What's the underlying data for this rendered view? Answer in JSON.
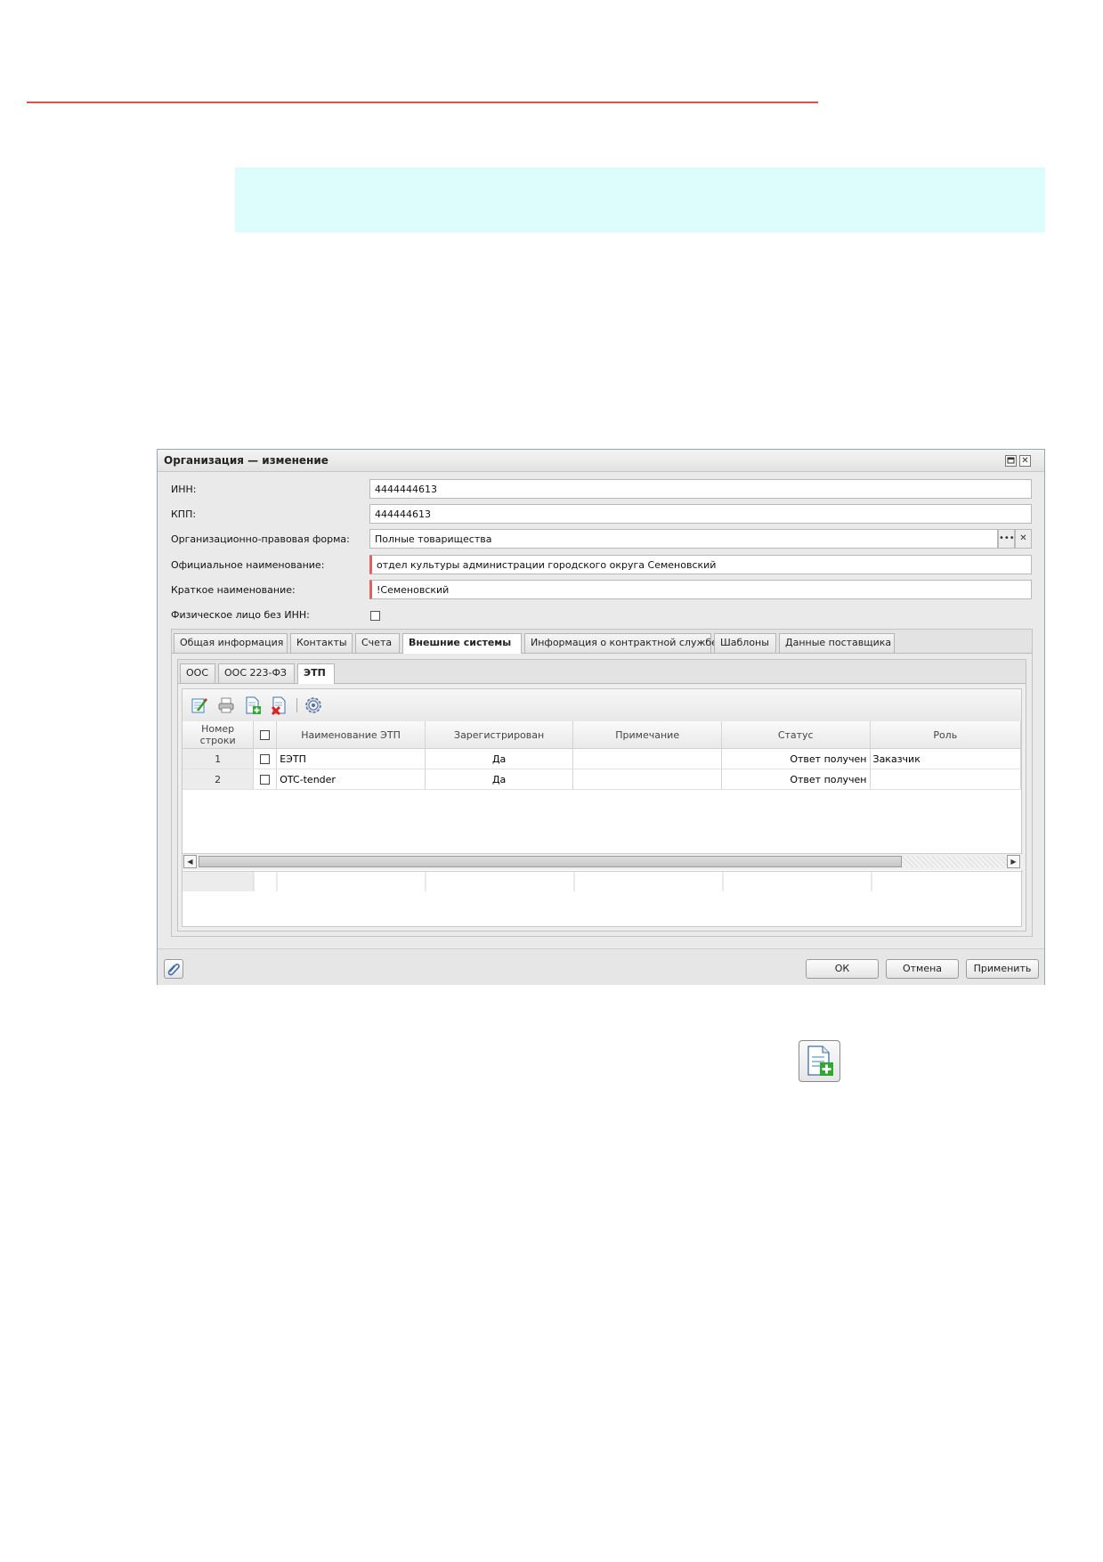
{
  "dialog": {
    "title": "Организация — изменение"
  },
  "form": {
    "inn": {
      "label": "ИНН:",
      "value": "4444444613"
    },
    "kpp": {
      "label": "КПП:",
      "value": "444444613"
    },
    "opf": {
      "label": "Организационно-правовая форма:",
      "value": "Полные товарищества"
    },
    "official_name": {
      "label": "Официальное наименование:",
      "value": "отдел культуры администрации городского округа Семеновский"
    },
    "short_name": {
      "label": "Краткое наименование:",
      "value": "!Семеновский"
    },
    "individual": {
      "label": "Физическое лицо без ИНН:",
      "checked": false
    }
  },
  "tabs": [
    {
      "label": "Общая информация"
    },
    {
      "label": "Контакты"
    },
    {
      "label": "Счета"
    },
    {
      "label": "Внешние системы",
      "active": true
    },
    {
      "label": "Информация о контрактной службе"
    },
    {
      "label": "Шаблоны"
    },
    {
      "label": "Данные поставщика"
    }
  ],
  "subtabs": [
    {
      "label": "ООС"
    },
    {
      "label": "ООС 223-ФЗ"
    },
    {
      "label": "ЭТП",
      "active": true
    }
  ],
  "toolbar_icons": [
    "edit-icon",
    "print-icon",
    "add-record-icon",
    "delete-record-icon",
    "settings-icon"
  ],
  "grid": {
    "headers": {
      "rownum": "Номер строки",
      "name": "Наименование ЭТП",
      "registered": "Зарегистрирован",
      "note": "Примечание",
      "status": "Статус",
      "role": "Роль"
    },
    "rows": [
      {
        "num": "1",
        "name": "ЕЭТП",
        "registered": "Да",
        "note": "",
        "status": "Ответ получен",
        "role": "Заказчик"
      },
      {
        "num": "2",
        "name": "OTC-tender",
        "registered": "Да",
        "note": "",
        "status": "Ответ получен",
        "role": ""
      }
    ]
  },
  "buttons": {
    "ok": "ОК",
    "cancel": "Отмена",
    "apply": "Применить"
  },
  "colors": {
    "accent_line": "#d9534f",
    "note_box": "#ddfdfd",
    "required_marker": "#e46060"
  }
}
